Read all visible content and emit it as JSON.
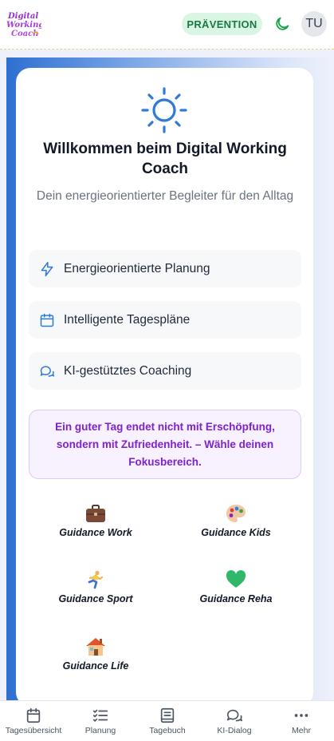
{
  "header": {
    "logo_text": "Digital Working Coach",
    "badge": "PRÄVENTION",
    "avatar_initials": "TU"
  },
  "welcome": {
    "title": "Willkommen beim Digital Working Coach",
    "subtitle": "Dein energieorientierter Begleiter für den Alltag"
  },
  "features": [
    {
      "icon": "lightning-icon",
      "label": "Energieorientierte Planung"
    },
    {
      "icon": "calendar-icon",
      "label": "Intelligente Tagespläne"
    },
    {
      "icon": "chat-bubbles-icon",
      "label": "KI-gestütztes Coaching"
    }
  ],
  "quote": "Ein guter Tag endet nicht mit Erschöpfung, sondern mit Zufriedenheit. – Wähle deinen Fokusbereich.",
  "guidance": [
    {
      "icon": "briefcase-icon",
      "label": "Guidance Work"
    },
    {
      "icon": "palette-icon",
      "label": "Guidance Kids"
    },
    {
      "icon": "runner-icon",
      "label": "Guidance Sport"
    },
    {
      "icon": "green-heart-icon",
      "label": "Guidance Reha"
    },
    {
      "icon": "house-icon",
      "label": "Guidance Life"
    }
  ],
  "nav": [
    {
      "icon": "calendar-icon",
      "label": "Tagesübersicht"
    },
    {
      "icon": "checklist-icon",
      "label": "Planung"
    },
    {
      "icon": "notebook-icon",
      "label": "Tagebuch"
    },
    {
      "icon": "chat-bubbles-icon",
      "label": "KI-Dialog"
    },
    {
      "icon": "more-dots-icon",
      "label": "Mehr"
    }
  ],
  "colors": {
    "accent_blue": "#2e7bd6",
    "badge_bg": "#d9f5e4",
    "badge_text": "#1a7a45",
    "quote_text": "#7e22ce",
    "logo_purple": "#9b2fd1"
  }
}
